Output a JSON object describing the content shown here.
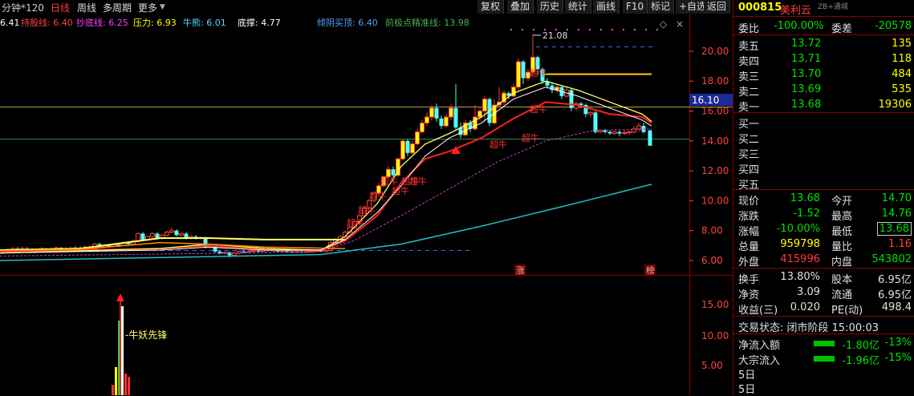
{
  "toolbar": {
    "period": "分钟*120",
    "tab_day": "日线",
    "tab_week": "周线",
    "tab_multi": "多周期",
    "tab_more": "更多",
    "menu": [
      "复权",
      "叠加",
      "历史",
      "统计",
      "画线",
      "F10",
      "标记",
      "+自选",
      "返回"
    ]
  },
  "indicators": [
    {
      "text": "6.41",
      "color": "#ffffff"
    },
    {
      "text": "持股线: 6.40",
      "color": "#ff4040"
    },
    {
      "text": "抄底线: 6.25",
      "color": "#ff40ff"
    },
    {
      "text": "压力: 6.93",
      "color": "#ffff00"
    },
    {
      "text": "牛熊: 6.01",
      "color": "#5fd7ff"
    },
    {
      "text": "底撑: 4.77",
      "color": "#ffffff"
    },
    {
      "text": "倾阴买顶: 6.40",
      "color": "#4da6ff"
    },
    {
      "text": "前极点精准线: 13.98",
      "color": "#4caf50"
    }
  ],
  "chart_labels": {
    "peak": "21.08",
    "current_price_tag": "16.10",
    "right_axis_main": [
      "20.00",
      "18.00",
      "16.00",
      "14.00",
      "12.00",
      "10.00",
      "8.00",
      "6.00"
    ],
    "right_axis_sub": [
      "15.00",
      "10.00",
      "5.00"
    ],
    "signals": [
      "超牛",
      "超牛",
      "超牛",
      "超牛",
      "超牛",
      "超牛",
      "超牛",
      "超牛",
      "超牛",
      "超牛"
    ],
    "limit_up_tag": "涨",
    "rank_tag": "榜",
    "sub_label": "牛妖先锋"
  },
  "colors": {
    "up": "#ff3b3b",
    "down": "#54ffff",
    "ma_red": "#ff2020",
    "ma_yellow": "#ffff60",
    "ma_white": "#ffffff",
    "ma_pink": "#c040c0",
    "ma_cyan": "#20c0c0",
    "grid": "#8a0000"
  },
  "quote": {
    "code": "000815",
    "name": "美利云",
    "name_sub": "ZB+通城",
    "weibi_label": "委比",
    "weibi_value": "-100.00%",
    "weicha_label": "委差",
    "weicha_value": "-20578",
    "asks": [
      {
        "label": "卖五",
        "price": "13.72",
        "vol": "135"
      },
      {
        "label": "卖四",
        "price": "13.71",
        "vol": "118"
      },
      {
        "label": "卖三",
        "price": "13.70",
        "vol": "484"
      },
      {
        "label": "卖二",
        "price": "13.69",
        "vol": "535"
      },
      {
        "label": "卖一",
        "price": "13.68",
        "vol": "19306"
      }
    ],
    "bids": [
      {
        "label": "买一"
      },
      {
        "label": "买二"
      },
      {
        "label": "买三"
      },
      {
        "label": "买四"
      },
      {
        "label": "买五"
      }
    ],
    "stats": [
      {
        "l1": "现价",
        "v1": "13.68",
        "c1": "green",
        "l2": "今开",
        "v2": "14.70",
        "c2": "green"
      },
      {
        "l1": "涨跌",
        "v1": "-1.52",
        "c1": "green",
        "l2": "最高",
        "v2": "14.76",
        "c2": "green"
      },
      {
        "l1": "涨幅",
        "v1": "-10.00%",
        "c1": "green",
        "l2": "最低",
        "v2": "13.68",
        "c2": "green"
      },
      {
        "l1": "总量",
        "v1": "959798",
        "c1": "yellow",
        "l2": "量比",
        "v2": "1.16",
        "c2": "red"
      },
      {
        "l1": "外盘",
        "v1": "415996",
        "c1": "red",
        "l2": "内盘",
        "v2": "543802",
        "c2": "green"
      }
    ],
    "fund": [
      {
        "l1": "换手",
        "v1": "13.80%",
        "l2": "股本",
        "v2": "6.95亿"
      },
      {
        "l1": "净资",
        "v1": "3.09",
        "l2": "流通",
        "v2": "6.95亿"
      },
      {
        "l1": "收益(三)",
        "v1": "0.020",
        "l2": "PE(动)",
        "v2": "498.4"
      }
    ],
    "trade_status": "交易状态: 闭市阶段 15:00:03",
    "flows": [
      {
        "label": "净流入额",
        "value": "-1.80亿",
        "pct": "-13%"
      },
      {
        "label": "大宗流入",
        "value": "-1.96亿",
        "pct": "-15%"
      }
    ],
    "day5_a": "5日",
    "day5_b": "5日"
  }
}
